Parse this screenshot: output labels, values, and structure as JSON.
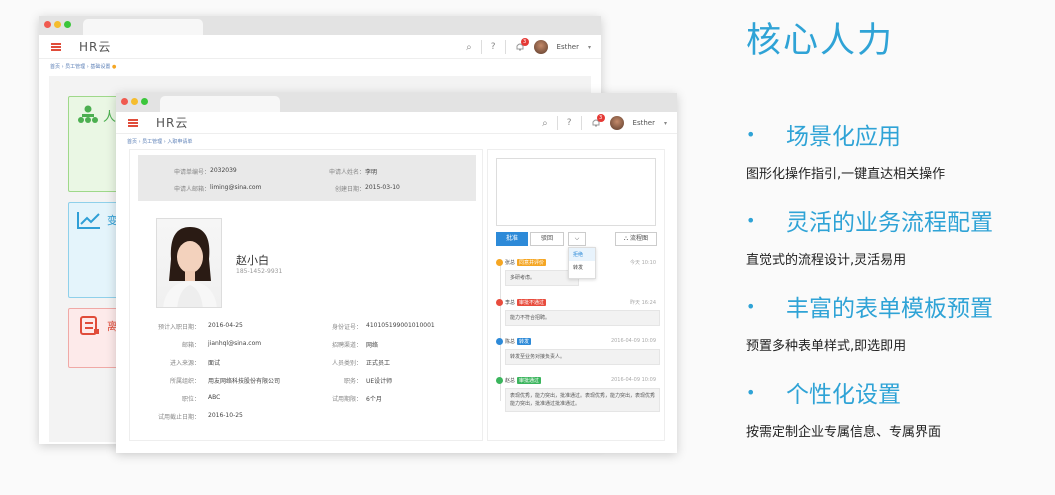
{
  "feature_panel": {
    "title": "核心人力",
    "features": [
      {
        "heading": "场景化应用",
        "desc": "图形化操作指引,一键直达相关操作"
      },
      {
        "heading": "灵活的业务流程配置",
        "desc": "直觉式的流程设计,灵活易用"
      },
      {
        "heading": "丰富的表单模板预置",
        "desc": "预置多种表单样式,即选即用"
      },
      {
        "heading": "个性化设置",
        "desc": "按需定制企业专属信息、专属界面"
      }
    ],
    "bullet": "•"
  },
  "app": {
    "logo": "HR云",
    "user": "Esther",
    "notif_count": "3",
    "search_icon": "⌕",
    "help_icon": "?",
    "caret": "▾"
  },
  "back_window": {
    "breadcrumb": "首页 › 员工管理 › 基础设置",
    "cards": [
      "人",
      "变",
      "离"
    ]
  },
  "front_window": {
    "breadcrumb": "首页 › 员工管理 › 入职申请单",
    "top_info": [
      {
        "label": "申请单编号：",
        "value": "2032039"
      },
      {
        "label": "申请人姓名：",
        "value": "李明"
      },
      {
        "label": "申请人邮箱：",
        "value": "liming@sina.com"
      },
      {
        "label": "创建日期：",
        "value": "2015-03-10"
      }
    ],
    "candidate": {
      "name": "赵小白",
      "phone": "185-1452-9931"
    },
    "details_left": [
      {
        "label": "预计入职日期：",
        "value": "2016-04-25"
      },
      {
        "label": "邮箱：",
        "value": "jianhql@sina.com"
      },
      {
        "label": "进入来源：",
        "value": "面试"
      },
      {
        "label": "所属组织：",
        "value": "用友网络科技股份有限公司"
      },
      {
        "label": "职位：",
        "value": "ABC"
      },
      {
        "label": "试用截止日期：",
        "value": "2016-10-25"
      }
    ],
    "details_right": [
      {
        "label": "身份证号：",
        "value": "410105199001010001"
      },
      {
        "label": "招聘渠道：",
        "value": "网络"
      },
      {
        "label": "人员类别：",
        "value": "正式员工"
      },
      {
        "label": "职务：",
        "value": "UE设计师"
      },
      {
        "label": "试用期限：",
        "value": "6个月"
      }
    ],
    "actions": {
      "approve": "批准",
      "reject": "驳回",
      "more": "⌵",
      "flowchart": "流程图",
      "dropdown": [
        "拒绝",
        "转发"
      ]
    },
    "timeline": [
      {
        "name": "张总",
        "status": "同意并评价",
        "status_color": "#f5a623",
        "time": "今天 10:10",
        "comment": "多研考虑。",
        "icon_color": "#f5a623"
      },
      {
        "name": "李总",
        "status": "审批不通过",
        "status_color": "#e84c3d",
        "time": "昨天 16:24",
        "comment": "能力不符合招聘。",
        "icon_color": "#e84c3d"
      },
      {
        "name": "陈总",
        "status": "转发",
        "status_color": "#2d8ad8",
        "time": "2016-04-09  10:09",
        "comment": "转发至业务对接负责人。",
        "icon_color": "#2d8ad8"
      },
      {
        "name": "赵总",
        "status": "审批通过",
        "status_color": "#3bb55d",
        "time": "2016-04-09  10:09",
        "comment": "表现优秀，能力突出，批准通过。表现优秀，能力突出，表现优秀能力突出，批准通过批准通过。",
        "icon_color": "#3bb55d"
      }
    ]
  }
}
